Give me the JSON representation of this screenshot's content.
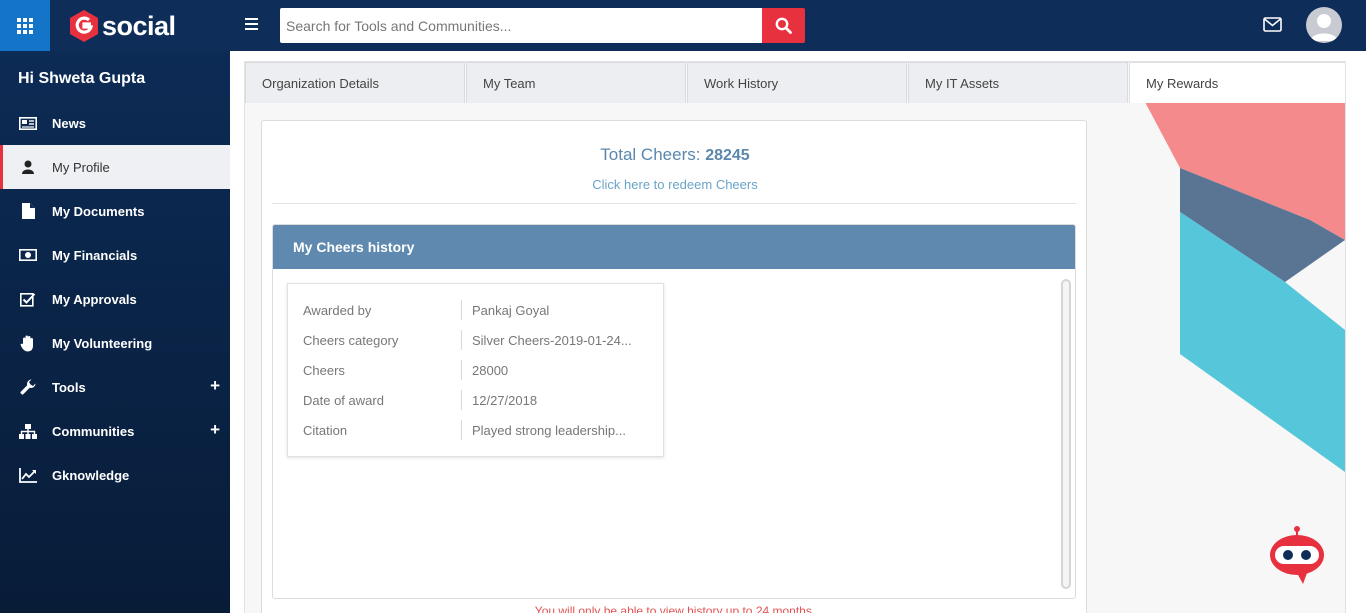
{
  "header": {
    "brand": "social",
    "search_placeholder": "Search for Tools and Communities...",
    "icons": {
      "apps": "apps-grid-icon",
      "menu": "hamburger-icon",
      "search": "search-icon",
      "mail": "mail-icon",
      "user": "user-avatar-icon"
    }
  },
  "sidebar": {
    "greeting": "Hi Shweta Gupta",
    "items": [
      {
        "label": "News",
        "icon": "newspaper-icon"
      },
      {
        "label": "My Profile",
        "icon": "user-icon"
      },
      {
        "label": "My Documents",
        "icon": "document-icon"
      },
      {
        "label": "My Financials",
        "icon": "money-icon"
      },
      {
        "label": "My Approvals",
        "icon": "check-square-icon"
      },
      {
        "label": "My Volunteering",
        "icon": "hand-icon"
      },
      {
        "label": "Tools",
        "icon": "wrench-icon",
        "expand": "+"
      },
      {
        "label": "Communities",
        "icon": "sitemap-icon",
        "expand": "+"
      },
      {
        "label": "Gknowledge",
        "icon": "chart-icon"
      }
    ],
    "active_item": "My Profile"
  },
  "tabs": [
    {
      "label": "Organization Details"
    },
    {
      "label": "My Team"
    },
    {
      "label": "Work History"
    },
    {
      "label": "My IT Assets"
    },
    {
      "label": "My Rewards"
    }
  ],
  "active_tab": "My Rewards",
  "rewards": {
    "total_label": "Total Cheers:",
    "total_value": "28245",
    "redeem_link": "Click here to redeem Cheers",
    "history_title": "My Cheers history",
    "record": {
      "awarded_by_label": "Awarded by",
      "awarded_by": "Pankaj Goyal",
      "category_label": "Cheers category",
      "category": "Silver Cheers-2019-01-24...",
      "cheers_label": "Cheers",
      "cheers": "28000",
      "date_label": "Date of award",
      "date": "12/27/2018",
      "citation_label": "Citation",
      "citation": "Played strong leadership..."
    },
    "note": "You will only be able to view history up to 24 months."
  },
  "colors": {
    "topbar": "#0e2d59",
    "apps_button": "#1474c8",
    "accent_red": "#e8313f",
    "header_blue": "#5f89ae"
  }
}
